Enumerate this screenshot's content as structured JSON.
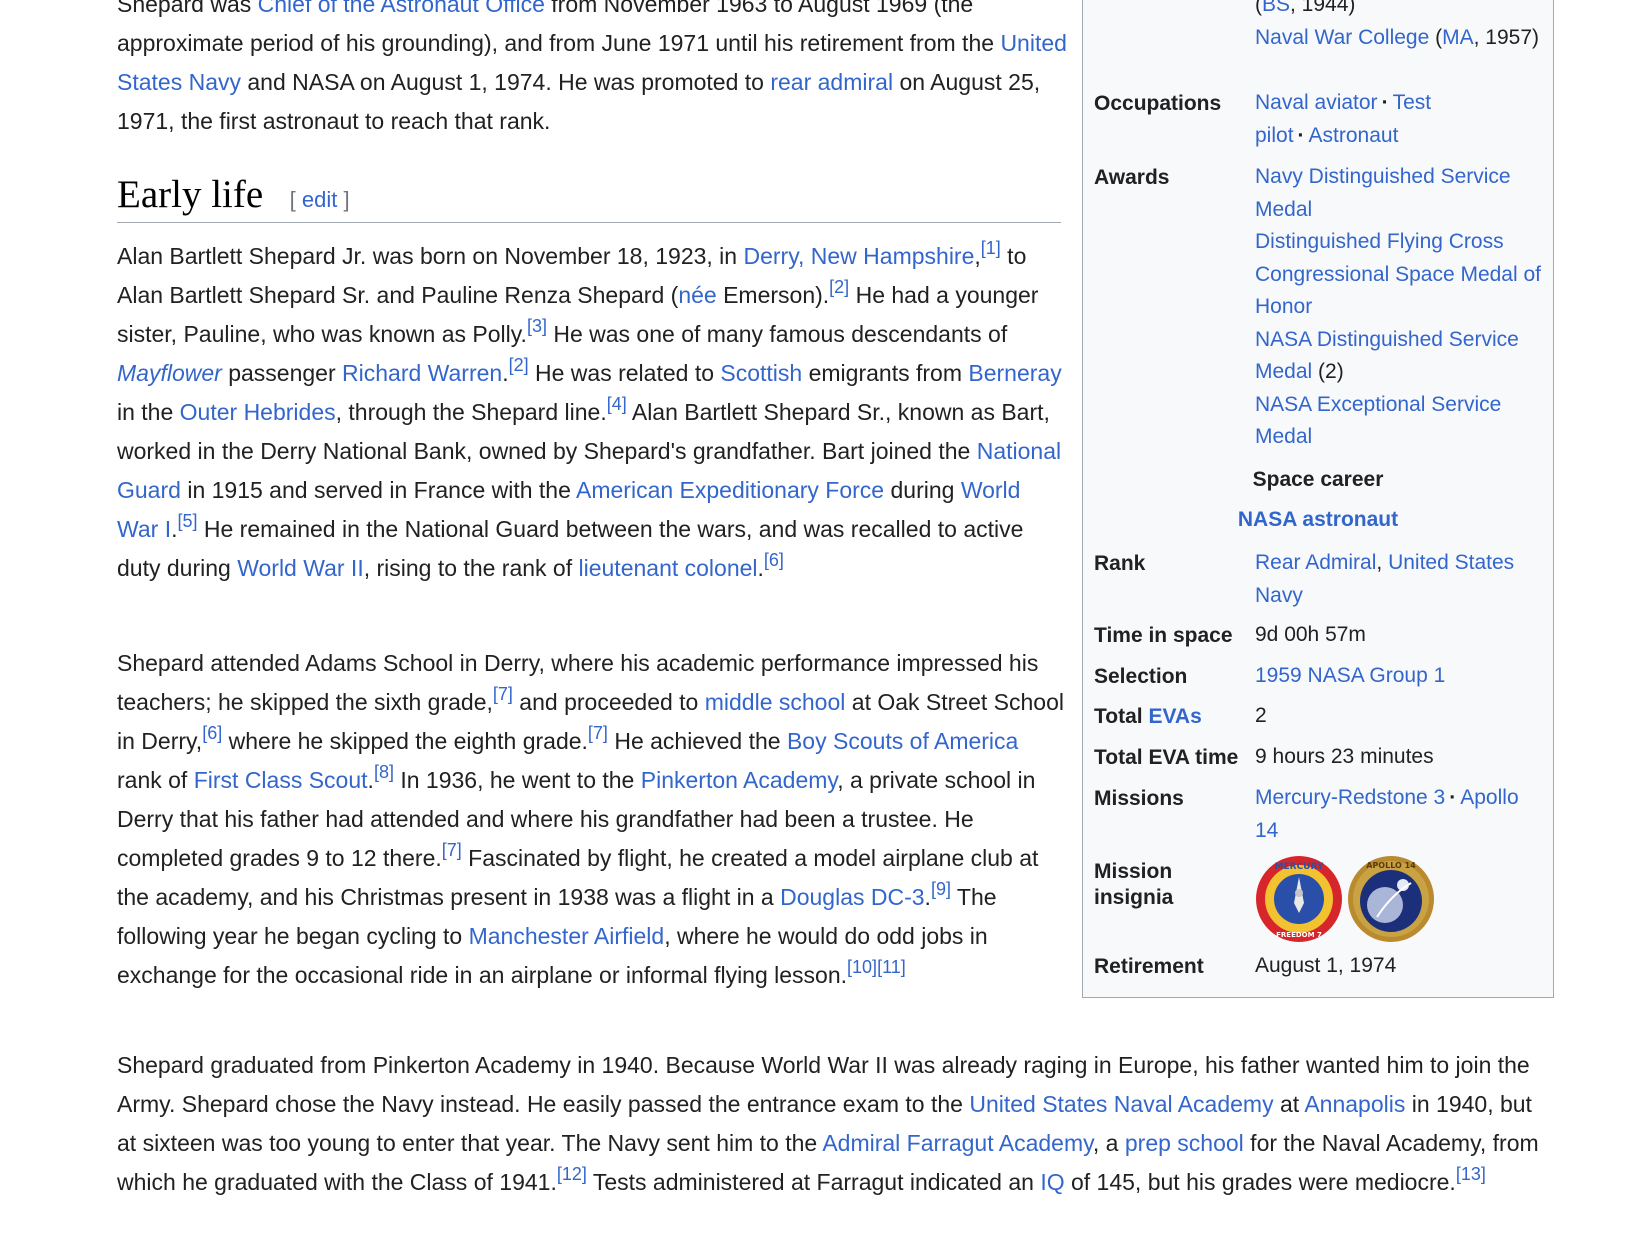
{
  "lead": {
    "l1_pre": "Shepard was ",
    "l1_link": "Chief of the Astronaut Office",
    "l1_post": " from November 1963 to August 1969 (the approximate period of his grounding), and from June 1971 until his retirement from the ",
    "link_navy": "United States Navy",
    "mid": " and NASA on August 1, 1974. He was promoted to ",
    "link_rear": "rear admiral",
    "end": " on August 25, 1971, the first astronaut to reach that rank."
  },
  "section": {
    "title": "Early life",
    "bracket_open": "[",
    "edit": "edit",
    "bracket_close": "]"
  },
  "p1": {
    "a": "Alan Bartlett Shepard Jr. was born on November 18, 1923, in ",
    "derry": "Derry, New Hampshire",
    "r1": "[1]",
    "b": " to Alan Bartlett Shepard Sr. and Pauline Renza Shepard (",
    "nee": "née",
    "c": " Emerson).",
    "r2": "[2]",
    "d": " He had a younger sister, Pauline, who was known as Polly.",
    "r3": "[3]",
    "e": " He was one of many famous descendants of ",
    "mayflower": "Mayflower",
    "f": " passenger ",
    "warren": "Richard Warren",
    "r2b": "[2]",
    "g": " He was related to ",
    "scottish": "Scottish",
    "h": " emigrants from ",
    "berneray": "Berneray",
    "i": " in the ",
    "hebrides": "Outer Hebrides",
    "j": ", through the Shepard line.",
    "r4": "[4]",
    "k": " Alan Bartlett Shepard Sr., known as Bart, worked in the Derry National Bank, owned by Shepard's grandfather. Bart joined the ",
    "guard": "National Guard",
    "l": " in 1915 and served in France with the ",
    "aef": "American Expeditionary Force",
    "m": " during ",
    "ww1": "World War I",
    "r5": "[5]",
    "n": " He remained in the National Guard between the wars, and was recalled to active duty during ",
    "ww2": "World War II",
    "o": ", rising to the rank of ",
    "ltcol": "lieutenant colonel",
    "r6": "[6]"
  },
  "p2": {
    "a": "Shepard attended Adams School in Derry, where his academic performance impressed his teachers; he skipped the sixth grade,",
    "r7": "[7]",
    "b": " and proceeded to ",
    "middle": "middle school",
    "c": " at Oak Street School in Derry,",
    "r6": "[6]",
    "d": " where he skipped the eighth grade.",
    "r7b": "[7]",
    "e": " He achieved the ",
    "bsa": "Boy Scouts of America",
    "f": " rank of ",
    "fcs": "First Class Scout",
    "r8": "[8]",
    "g": " In 1936, he went to the ",
    "pinkerton": "Pinkerton Academy",
    "h": ", a private school in Derry that his father had attended and where his grandfather had been a trustee. He completed grades 9 to 12 there.",
    "r7c": "[7]",
    "i": " Fascinated by flight, he created a model airplane club at the academy, and his Christmas present in 1938 was a flight in a ",
    "dc3": "Douglas DC-3",
    "r9": "[9]",
    "j": " The following year he began cycling to ",
    "airfield": "Manchester Airfield",
    "k": ", where he would do odd jobs in exchange for the occasional ride in an airplane or informal flying lesson.",
    "r10": "[10]",
    "r11": "[11]"
  },
  "p3": {
    "a": "Shepard graduated from Pinkerton Academy in 1940. Because World War II was already raging in Europe, his father wanted him to join the Army. Shepard chose the Navy instead. He easily passed the entrance exam to the ",
    "usna": "United States Naval Academy",
    "b": " at ",
    "annapolis": "Annapolis",
    "c": " in 1940, but at sixteen was too young to enter that year. The Navy sent him to the ",
    "farragut": "Admiral Farragut Academy",
    "d": ", a ",
    "prep": "prep school",
    "e": " for the Naval Academy, from which he graduated with the Class of 1941.",
    "r12": "[12]",
    "f": " Tests administered at Farragut indicated an ",
    "iq": "IQ",
    "g": " of 145, but his grades were mediocre.",
    "r13": "[13]"
  },
  "infobox": {
    "edu_bs_open": "(",
    "edu_bs": "BS",
    "edu_bs_year": ", 1944)",
    "edu_nwc": "Naval War College",
    "edu_ma_open": " (",
    "edu_ma": "MA",
    "edu_ma_year": ", 1957)",
    "occupations_label": "Occupations",
    "occ1": "Naval aviator",
    "occ2": "Test pilot",
    "occ3": "Astronaut",
    "occ_sep": "·",
    "awards_label": "Awards",
    "award1": "Navy Distinguished Service Medal",
    "award2": "Distinguished Flying Cross",
    "award3": "Congressional Space Medal of Honor",
    "award4": "NASA Distinguished Service Medal",
    "award4_count": " (2)",
    "award5": "NASA Exceptional Service Medal",
    "space_career": "Space career",
    "nasa_astronaut": "NASA astronaut",
    "rank_label": "Rank",
    "rank1": "Rear Admiral",
    "rank_comma": ", ",
    "rank2": "United States Navy",
    "time_label": "Time in space",
    "time_value": "9d 00h 57m",
    "selection_label": "Selection",
    "selection_value": "1959 NASA Group 1",
    "total_pre": "Total ",
    "total_evas_link": "EVAs",
    "total_evas_value": "2",
    "eva_time_label": "Total EVA time",
    "eva_time_value": "9 hours 23 minutes",
    "missions_label": "Missions",
    "mission1": "Mercury-Redstone 3",
    "mission2": "Apollo 14",
    "insignia_label": "Mission insignia",
    "insignia1_text": "MERCURY",
    "insignia1_sub": "FREEDOM 7",
    "insignia2_text": "APOLLO 14",
    "retirement_label": "Retirement",
    "retirement_value": "August 1, 1974"
  }
}
